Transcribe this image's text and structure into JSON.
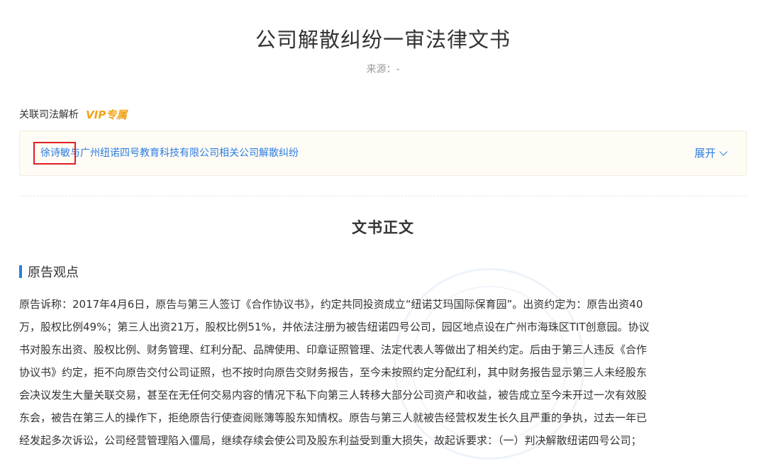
{
  "document": {
    "title": "公司解散纠纷一审法律文书",
    "source_label": "来源：-"
  },
  "related": {
    "label": "关联司法解析",
    "vip_badge": "VIP专属",
    "case_link_text": "徐诗敏与广州纽诺四号教育科技有限公司相关公司解散纠纷",
    "expand_label": "展开",
    "expand_icon": "chevron-down-icon"
  },
  "content": {
    "section_title": "文书正文",
    "sub_heading": "原告观点",
    "paragraph_lines": [
      "原告诉称：2017年4月6日，原告与第三人签订《合作协议书》，约定共同投资成立“纽诺艾玛国际保育园”。出资约定为：原告出资40",
      "万，股权比例49%；第三人出资21万，股权比例51%，并依法注册为被告纽诺四号公司，园区地点设在广州市海珠区TIT创意园。协议",
      "书对股东出资、股权比例、财务管理、红利分配、品牌使用、印章证照管理、法定代表人等做出了相关约定。后由于第三人违反《合作",
      "协议书》约定，拒不向原告交付公司证照，也不按时向原告交财务报告，至今未按照约定分配红利，其中财务报告显示第三人未经股东",
      "会决议发生大量关联交易，甚至在无任何交易内容的情况下私下向第三人转移大部分公司资产和收益，被告成立至今未开过一次有效股",
      "东会，被告在第三人的操作下，拒绝原告行使查阅账簿等股东知情权。原告与第三人就被告经营权发生长久且严重的争执，过去一年已",
      "经发起多次诉讼，公司经营管理陷入僵局，继续存续会使公司及股东利益受到重大损失，故起诉要求：（一）判决解散纽诺四号公司；"
    ]
  },
  "colors": {
    "accent_blue": "#2b7de1",
    "vip_orange": "#f0a317",
    "highlight_red": "#e02020"
  }
}
